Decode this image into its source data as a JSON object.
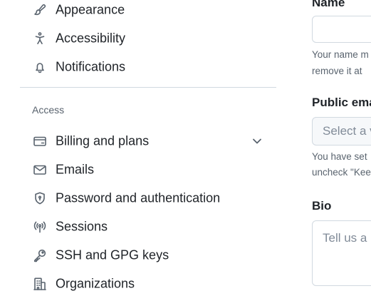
{
  "sidebar": {
    "items_top": [
      {
        "label": "Appearance",
        "icon": "paintbrush-icon"
      },
      {
        "label": "Accessibility",
        "icon": "accessibility-icon"
      },
      {
        "label": "Notifications",
        "icon": "bell-icon"
      }
    ],
    "access_heading": "Access",
    "items_access": [
      {
        "label": "Billing and plans",
        "icon": "credit-card-icon",
        "expandable": true
      },
      {
        "label": "Emails",
        "icon": "mail-icon"
      },
      {
        "label": "Password and authentication",
        "icon": "shield-lock-icon"
      },
      {
        "label": "Sessions",
        "icon": "broadcast-icon"
      },
      {
        "label": "SSH and GPG keys",
        "icon": "key-icon"
      },
      {
        "label": "Organizations",
        "icon": "organization-icon"
      }
    ]
  },
  "form": {
    "name": {
      "label": "Name",
      "value": "",
      "note_line1": "Your name m",
      "note_line2": "remove it at"
    },
    "public_email": {
      "label": "Public ema",
      "placeholder": "Select a v",
      "note_line1": "You have set",
      "note_line2": "uncheck \"Kee"
    },
    "bio": {
      "label": "Bio",
      "placeholder": "Tell us a l"
    }
  },
  "colors": {
    "text_primary": "#1f2328",
    "text_muted": "#59636e",
    "border": "#d1d9e0",
    "select_bg": "#f6f8fa"
  }
}
